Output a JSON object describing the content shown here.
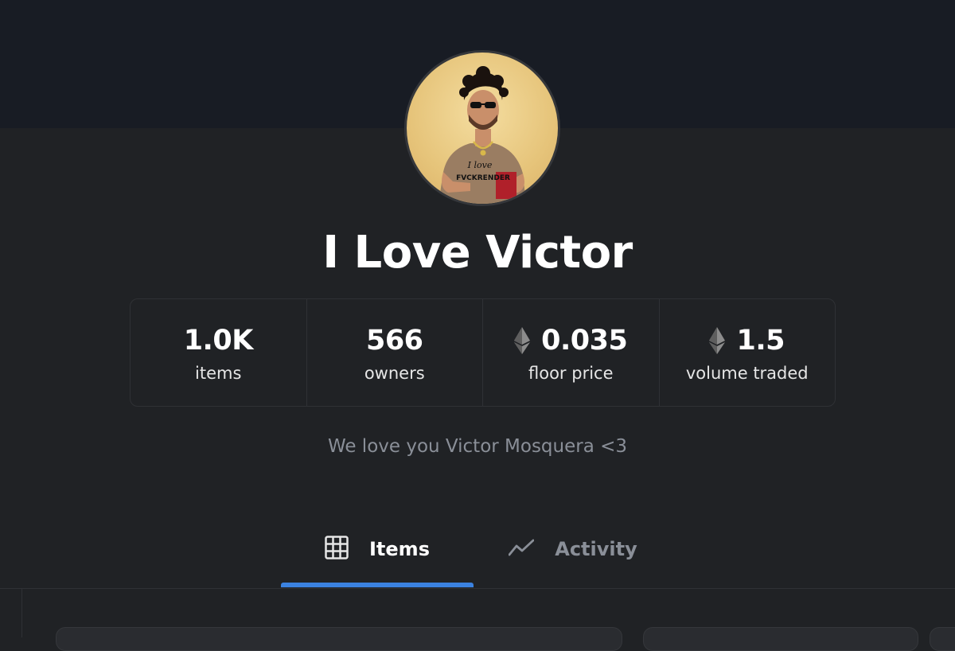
{
  "collection": {
    "title": "I Love Victor",
    "description": "We love you Victor Mosquera <3",
    "avatar_icon": "avatar-portrait",
    "avatar_text": [
      "I love",
      "FVCKRENDER"
    ]
  },
  "stats": [
    {
      "value": "1.0K",
      "label": "items",
      "icon": null
    },
    {
      "value": "566",
      "label": "owners",
      "icon": null
    },
    {
      "value": "0.035",
      "label": "floor price",
      "icon": "ethereum-icon"
    },
    {
      "value": "1.5",
      "label": "volume traded",
      "icon": "ethereum-icon"
    }
  ],
  "tabs": [
    {
      "label": "Items",
      "icon": "grid-icon",
      "active": true
    },
    {
      "label": "Activity",
      "icon": "activity-chart-icon",
      "active": false
    }
  ],
  "colors": {
    "accent": "#3b82e0",
    "banner": "#181c24",
    "background": "#202225",
    "muted_text": "#8a8f98"
  }
}
